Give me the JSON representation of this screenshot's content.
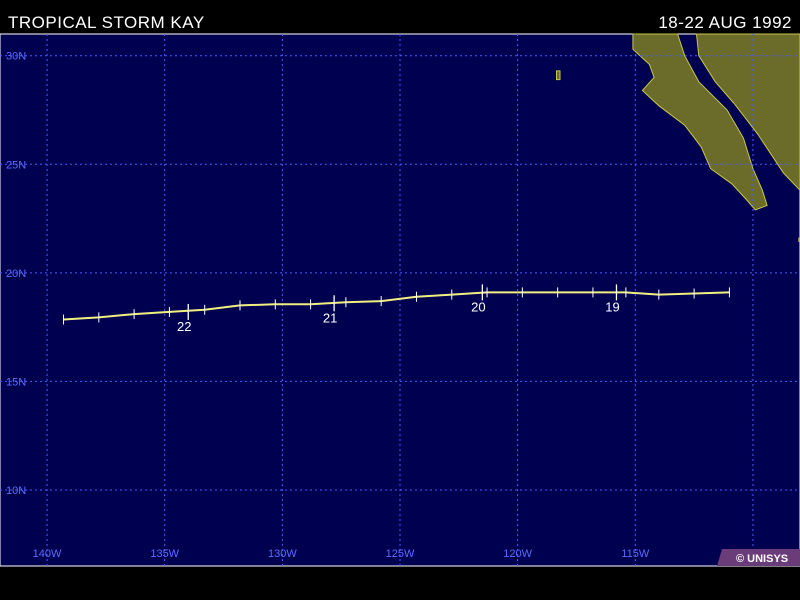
{
  "header": {
    "title": "TROPICAL STORM KAY",
    "dates": "18-22 AUG 1992"
  },
  "credit": "© UNISYS",
  "colors": {
    "ocean": "#000050",
    "land": "#6b6b2a",
    "coast": "#c8c84a",
    "grid": "#4a5cff",
    "track": "#f0f080",
    "labels": "#5a6cff"
  },
  "map": {
    "lon_range": [
      -142,
      -108
    ],
    "lat_range": [
      6.5,
      31
    ],
    "lat_ticks": [
      {
        "value": 30,
        "label": "30N"
      },
      {
        "value": 25,
        "label": "25N"
      },
      {
        "value": 20,
        "label": "20N"
      },
      {
        "value": 15,
        "label": "15N"
      },
      {
        "value": 10,
        "label": "10N"
      }
    ],
    "lon_ticks": [
      {
        "value": -140,
        "label": "140W"
      },
      {
        "value": -135,
        "label": "135W"
      },
      {
        "value": -130,
        "label": "130W"
      },
      {
        "value": -125,
        "label": "125W"
      },
      {
        "value": -120,
        "label": "120W"
      },
      {
        "value": -115,
        "label": "115W"
      },
      {
        "value": -110,
        "label": "110W"
      }
    ]
  },
  "track": {
    "points": [
      {
        "lon": -111.0,
        "lat": 19.1
      },
      {
        "lon": -112.5,
        "lat": 19.05
      },
      {
        "lon": -114.0,
        "lat": 19.0
      },
      {
        "lon": -115.4,
        "lat": 19.1
      },
      {
        "lon": -116.8,
        "lat": 19.1
      },
      {
        "lon": -118.3,
        "lat": 19.1
      },
      {
        "lon": -119.8,
        "lat": 19.1
      },
      {
        "lon": -121.3,
        "lat": 19.1
      },
      {
        "lon": -122.8,
        "lat": 19.0
      },
      {
        "lon": -124.3,
        "lat": 18.9
      },
      {
        "lon": -125.8,
        "lat": 18.7
      },
      {
        "lon": -127.3,
        "lat": 18.65
      },
      {
        "lon": -128.8,
        "lat": 18.55
      },
      {
        "lon": -130.3,
        "lat": 18.55
      },
      {
        "lon": -131.8,
        "lat": 18.5
      },
      {
        "lon": -133.3,
        "lat": 18.3
      },
      {
        "lon": -134.8,
        "lat": 18.2
      },
      {
        "lon": -136.3,
        "lat": 18.1
      },
      {
        "lon": -137.8,
        "lat": 17.95
      },
      {
        "lon": -139.3,
        "lat": 17.85
      }
    ],
    "day_labels": [
      {
        "text": "19",
        "lon": -115.8,
        "lat": 19.1
      },
      {
        "text": "20",
        "lon": -121.5,
        "lat": 19.1
      },
      {
        "text": "21",
        "lon": -127.8,
        "lat": 18.6
      },
      {
        "text": "22",
        "lon": -134.0,
        "lat": 18.2
      }
    ]
  },
  "land": {
    "baja": [
      [
        -115.1,
        31.0
      ],
      [
        -113.2,
        31.0
      ],
      [
        -112.9,
        30.0
      ],
      [
        -112.3,
        28.8
      ],
      [
        -111.1,
        27.5
      ],
      [
        -110.4,
        26.2
      ],
      [
        -110.0,
        24.8
      ],
      [
        -109.6,
        23.8
      ],
      [
        -109.4,
        23.1
      ],
      [
        -109.9,
        22.9
      ],
      [
        -110.3,
        23.4
      ],
      [
        -110.9,
        24.1
      ],
      [
        -111.8,
        24.8
      ],
      [
        -112.2,
        25.8
      ],
      [
        -112.9,
        26.8
      ],
      [
        -114.0,
        27.7
      ],
      [
        -114.7,
        28.4
      ],
      [
        -114.2,
        29.0
      ],
      [
        -114.4,
        29.6
      ],
      [
        -115.1,
        30.3
      ]
    ],
    "mainland": [
      [
        -112.4,
        31.0
      ],
      [
        -108.0,
        31.0
      ],
      [
        -108.0,
        23.8
      ],
      [
        -108.7,
        24.6
      ],
      [
        -109.8,
        26.4
      ],
      [
        -110.8,
        27.8
      ],
      [
        -111.6,
        28.8
      ],
      [
        -112.3,
        30.0
      ]
    ],
    "islands": [
      [
        [
          -118.35,
          29.3
        ],
        [
          -118.2,
          29.3
        ],
        [
          -118.2,
          28.9
        ],
        [
          -118.35,
          28.9
        ]
      ],
      [
        [
          -108.05,
          21.6
        ],
        [
          -108.0,
          21.6
        ],
        [
          -108.0,
          21.45
        ],
        [
          -108.05,
          21.45
        ]
      ]
    ]
  }
}
